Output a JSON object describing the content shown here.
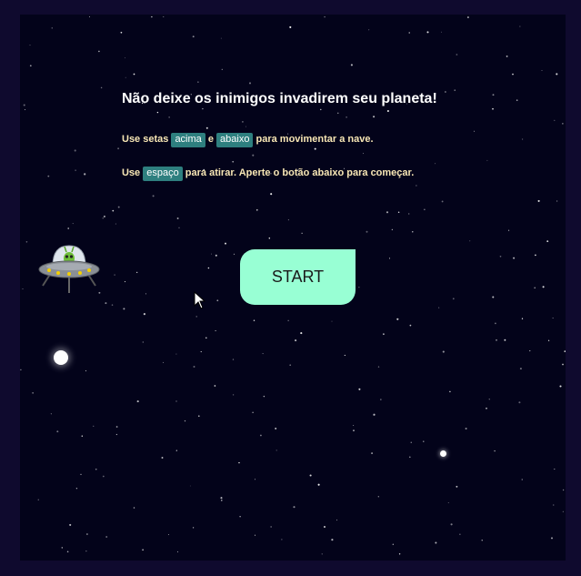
{
  "instructions": {
    "title": "Não deixe os inimigos invadirem seu planeta!",
    "line1_prefix": "Use setas",
    "line1_key1": "acima",
    "line1_mid": "e",
    "line1_key2": "abaixo",
    "line1_suffix": "para movimentar a nave.",
    "line2_prefix": "Use",
    "line2_key": "espaço",
    "line2_suffix": "para atirar. Aperte o botão abaixo para começar."
  },
  "start_button": {
    "label": "START"
  },
  "colors": {
    "frame_background": "#0f0a2e",
    "game_background": "#03031a",
    "start_button": "#98ffd4",
    "key_badge": "#2e7f7f",
    "instruction_text": "#f8e7b5"
  },
  "icons": {
    "player": "ufo-alien-icon",
    "cursor": "mouse-pointer-icon"
  }
}
